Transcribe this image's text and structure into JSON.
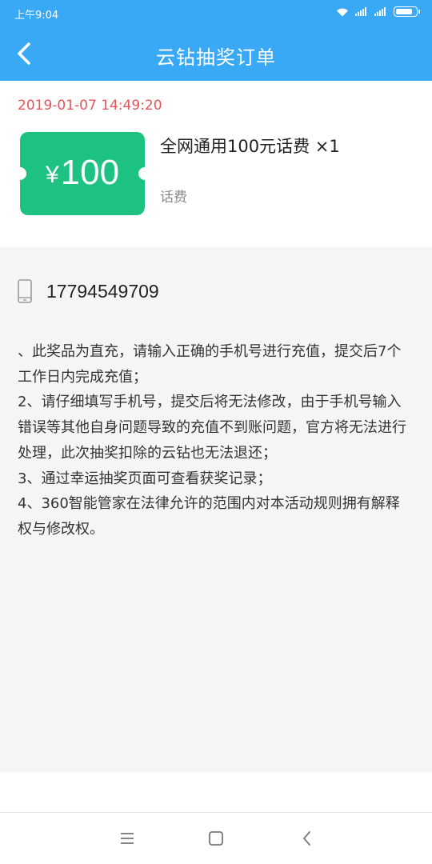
{
  "status_bar": {
    "time": "上午9:04"
  },
  "nav": {
    "title": "云钻抽奖订单",
    "back_icon": "chevron-left-icon"
  },
  "order": {
    "time": "2019-01-07 14:49:20",
    "coupon": {
      "currency": "¥",
      "amount": "100",
      "color": "#1dc282"
    },
    "product_name": "全网通用100元话费 ×1",
    "product_type": "话费"
  },
  "recharge": {
    "phone_icon": "phone-icon",
    "phone_number": "17794549709"
  },
  "rules": [
    "、此奖品为直充，请输入正确的手机号进行充值，提交后7个工作日内完成充值；",
    "2、请仔细填写手机号，提交后将无法修改，由于手机号输入错误等其他自身问题导致的充值不到账问题，官方将无法进行处理，此次抽奖扣除的云钻也无法退还；",
    "3、通过幸运抽奖页面可查看获奖记录；",
    "4、360智能管家在法律允许的范围内对本活动规则拥有解释权与修改权。"
  ],
  "colors": {
    "accent": "#3aa9f5",
    "time_red": "#e2555a"
  }
}
